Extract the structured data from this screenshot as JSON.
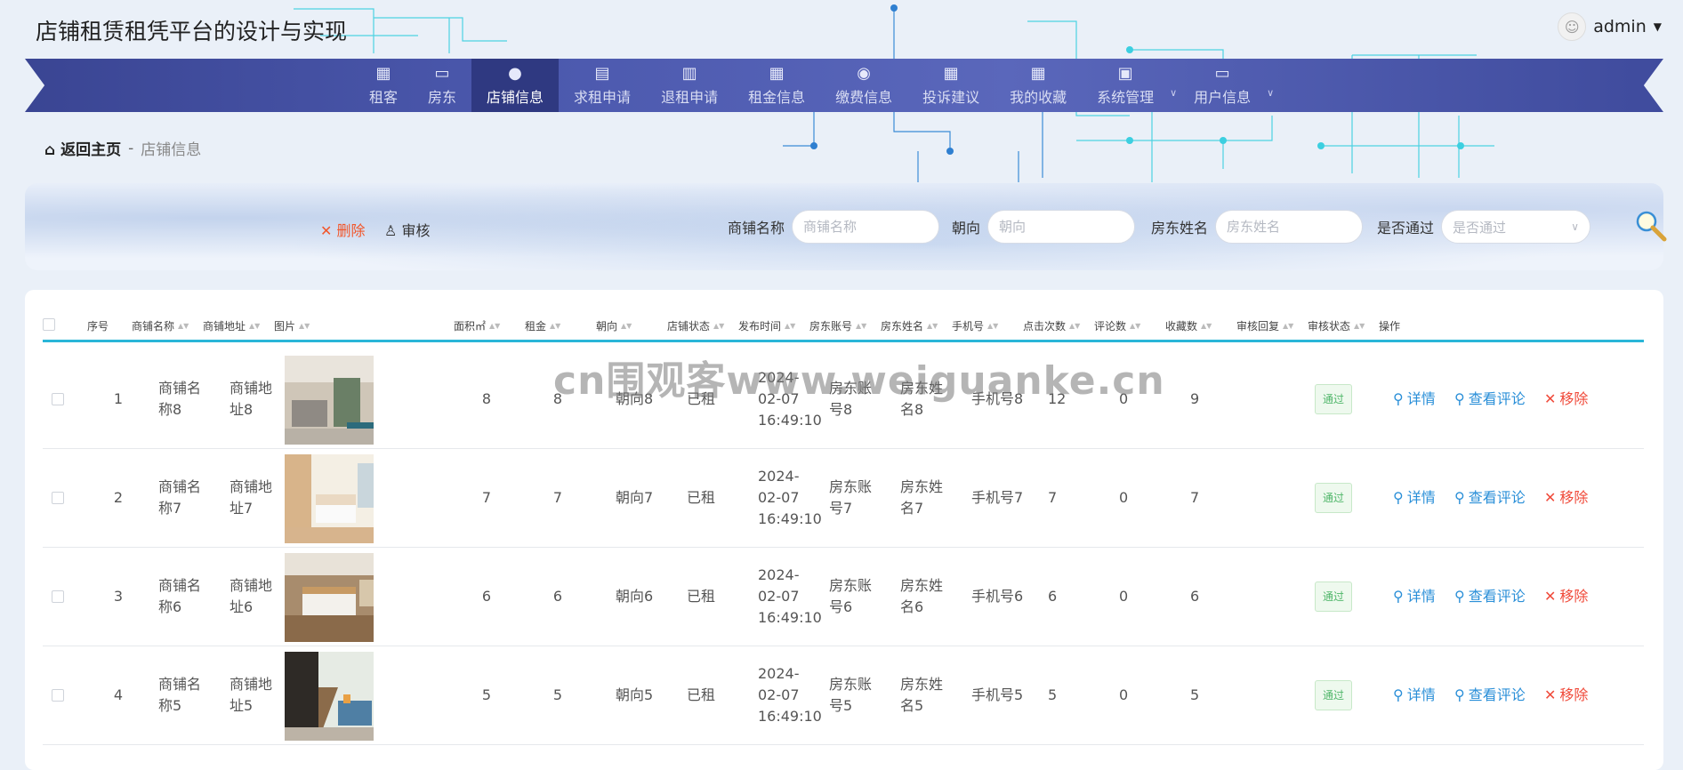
{
  "app": {
    "title": "店铺租赁租凭平台的设计与实现"
  },
  "user": {
    "name": "admin"
  },
  "nav": {
    "items": [
      {
        "label": "租客",
        "icon": "grid-icon"
      },
      {
        "label": "房东",
        "icon": "monitor-icon"
      },
      {
        "label": "店铺信息",
        "icon": "user-icon",
        "active": true
      },
      {
        "label": "求租申请",
        "icon": "chat-icon"
      },
      {
        "label": "退租申请",
        "icon": "clipboard-icon"
      },
      {
        "label": "租金信息",
        "icon": "grid-icon"
      },
      {
        "label": "缴费信息",
        "icon": "bulb-icon"
      },
      {
        "label": "投诉建议",
        "icon": "grid-icon"
      },
      {
        "label": "我的收藏",
        "icon": "grid-icon"
      },
      {
        "label": "系统管理",
        "icon": "briefcase-icon",
        "dropdown": true
      },
      {
        "label": "用户信息",
        "icon": "card-icon",
        "dropdown": true
      }
    ]
  },
  "breadcrumb": {
    "home": "返回主页",
    "separator": "-",
    "current": "店铺信息"
  },
  "toolbar": {
    "delete_label": "删除",
    "audit_label": "审核"
  },
  "search": {
    "shop_name": {
      "label": "商铺名称",
      "placeholder": "商铺名称"
    },
    "orientation": {
      "label": "朝向",
      "placeholder": "朝向"
    },
    "landlord_name": {
      "label": "房东姓名",
      "placeholder": "房东姓名"
    },
    "approved": {
      "label": "是否通过",
      "placeholder": "是否通过"
    }
  },
  "table": {
    "headers": {
      "index": "序号",
      "shop_name": "商铺名称",
      "shop_address": "商铺地址",
      "image": "图片",
      "area": "面积㎡",
      "rent": "租金",
      "orientation": "朝向",
      "shop_status": "店铺状态",
      "publish_time": "发布时间",
      "landlord_account": "房东账号",
      "landlord_name": "房东姓名",
      "phone": "手机号",
      "clicks": "点击次数",
      "comments": "评论数",
      "favorites": "收藏数",
      "audit_reply": "审核回复",
      "audit_status": "审核状态",
      "actions": "操作"
    },
    "rows": [
      {
        "index": "1",
        "shop_name": "商铺名称8",
        "shop_address": "商铺地址8",
        "area": "8",
        "rent": "8",
        "orientation": "朝向8",
        "shop_status": "已租",
        "publish_time": "2024-02-07 16:49:10",
        "landlord_account": "房东账号8",
        "landlord_name": "房东姓名8",
        "phone": "手机号8",
        "clicks": "12",
        "comments": "0",
        "favorites": "9",
        "audit_reply": "",
        "audit_status": "通过",
        "act_detail": "详情",
        "act_comments": "查看评论",
        "act_remove": "移除",
        "img": "living-room"
      },
      {
        "index": "2",
        "shop_name": "商铺名称7",
        "shop_address": "商铺地址7",
        "area": "7",
        "rent": "7",
        "orientation": "朝向7",
        "shop_status": "已租",
        "publish_time": "2024-02-07 16:49:10",
        "landlord_account": "房东账号7",
        "landlord_name": "房东姓名7",
        "phone": "手机号7",
        "clicks": "7",
        "comments": "0",
        "favorites": "7",
        "audit_reply": "",
        "audit_status": "通过",
        "act_detail": "详情",
        "act_comments": "查看评论",
        "act_remove": "移除",
        "img": "bedroom-bright"
      },
      {
        "index": "3",
        "shop_name": "商铺名称6",
        "shop_address": "商铺地址6",
        "area": "6",
        "rent": "6",
        "orientation": "朝向6",
        "shop_status": "已租",
        "publish_time": "2024-02-07 16:49:10",
        "landlord_account": "房东账号6",
        "landlord_name": "房东姓名6",
        "phone": "手机号6",
        "clicks": "6",
        "comments": "0",
        "favorites": "6",
        "audit_reply": "",
        "audit_status": "通过",
        "act_detail": "详情",
        "act_comments": "查看评论",
        "act_remove": "移除",
        "img": "bedroom-wood"
      },
      {
        "index": "4",
        "shop_name": "商铺名称5",
        "shop_address": "商铺地址5",
        "area": "5",
        "rent": "5",
        "orientation": "朝向5",
        "shop_status": "已租",
        "publish_time": "2024-02-07 16:49:10",
        "landlord_account": "房东账号5",
        "landlord_name": "房东姓名5",
        "phone": "手机号5",
        "clicks": "5",
        "comments": "0",
        "favorites": "5",
        "audit_reply": "",
        "audit_status": "通过",
        "act_detail": "详情",
        "act_comments": "查看评论",
        "act_remove": "移除",
        "img": "loft-stairs"
      }
    ]
  },
  "watermark": "cn围观客www.weiguanke.cn"
}
